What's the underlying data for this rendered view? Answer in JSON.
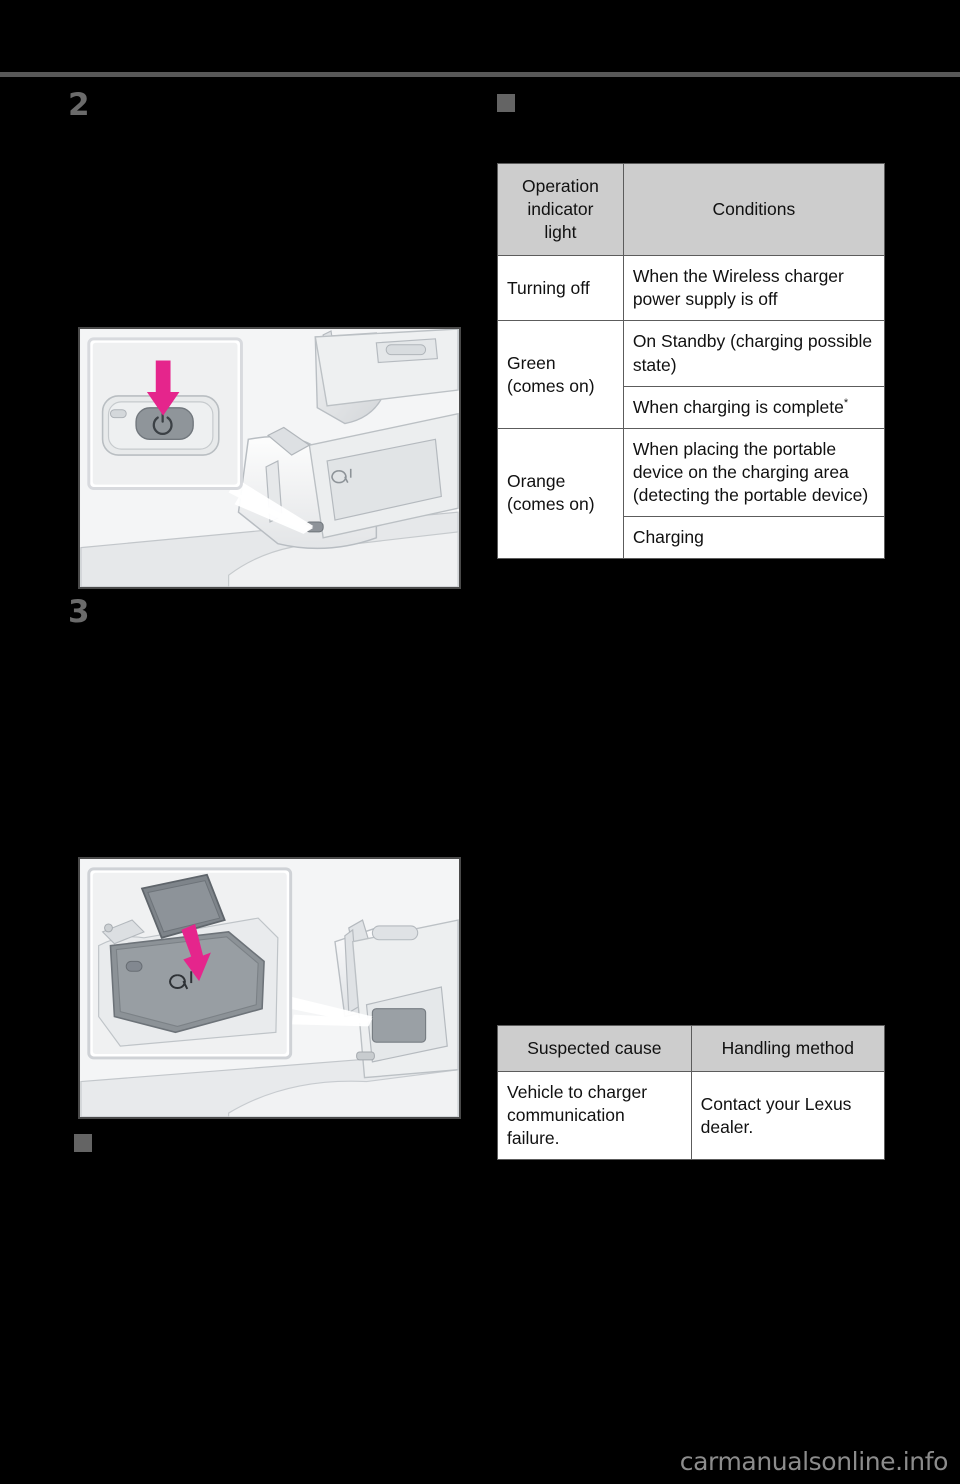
{
  "page": {
    "background_color": "#000000",
    "rule_color": "#585858",
    "accent_arrow_color": "#e5258c",
    "watermark": "carmanualsonline.info"
  },
  "steps": [
    {
      "number": "2",
      "name": "step-2"
    },
    {
      "number": "3",
      "name": "step-3"
    }
  ],
  "illustrations": [
    {
      "name": "console-power-button-illustration",
      "alt": "Center console with wireless charger power button, inset close-up, magenta arrow pressing the power button",
      "icon": "power-icon"
    },
    {
      "name": "phone-on-charging-pad-illustration",
      "alt": "Portable device being placed on the console charging area marked with the Qi logo, magenta arrow pointing down",
      "icon": "qi-icon"
    }
  ],
  "indicator_table": {
    "name": "operation-indicator-light-table",
    "headers": [
      "Operation indicator light",
      "Conditions"
    ],
    "header_lines": [
      [
        "Operation",
        "indicator",
        "light"
      ],
      [
        "Conditions"
      ]
    ],
    "rows": [
      {
        "light_lines": [
          "Turning off"
        ],
        "conditions": [
          "When the Wireless charger power supply is off"
        ]
      },
      {
        "light_lines": [
          "Green",
          "(comes on)"
        ],
        "conditions": [
          "On Standby (charging possible state)",
          "When charging is complete"
        ],
        "footnote_on_last": "*"
      },
      {
        "light_lines": [
          "Orange",
          "(comes on)"
        ],
        "conditions": [
          "When placing the portable device on the charging area (detecting the portable device)",
          "Charging"
        ]
      }
    ]
  },
  "trouble_table": {
    "name": "troubleshooting-table",
    "headers": [
      "Suspected cause",
      "Handling method"
    ],
    "rows": [
      {
        "cause": "Vehicle to charger communication failure.",
        "method": "Contact your Lexus dealer."
      }
    ]
  }
}
